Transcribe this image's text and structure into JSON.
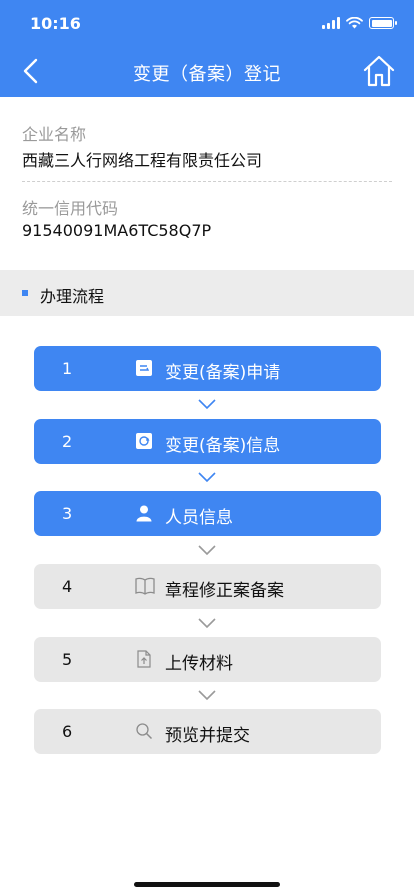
{
  "status_bar": {
    "time": "10:16"
  },
  "nav": {
    "title": "变更（备案）登记"
  },
  "company": {
    "name_label": "企业名称",
    "name_value": "西藏三人行网络工程有限责任公司",
    "code_label": "统一信用代码",
    "code_value": "91540091MA6TC58Q7P"
  },
  "section": {
    "title": "办理流程"
  },
  "steps": [
    {
      "number": "1",
      "label": "变更(备案)申请",
      "icon": "edit-doc-icon",
      "state": "active"
    },
    {
      "number": "2",
      "label": "变更(备案)信息",
      "icon": "refresh-doc-icon",
      "state": "active"
    },
    {
      "number": "3",
      "label": "人员信息",
      "icon": "person-icon",
      "state": "active"
    },
    {
      "number": "4",
      "label": "章程修正案备案",
      "icon": "book-icon",
      "state": "inactive"
    },
    {
      "number": "5",
      "label": "上传材料",
      "icon": "upload-icon",
      "state": "inactive"
    },
    {
      "number": "6",
      "label": "预览并提交",
      "icon": "search-icon",
      "state": "inactive"
    }
  ],
  "colors": {
    "accent": "#3f86f2",
    "inactive_bg": "#e7e7e7",
    "section_bg": "#ececec"
  }
}
